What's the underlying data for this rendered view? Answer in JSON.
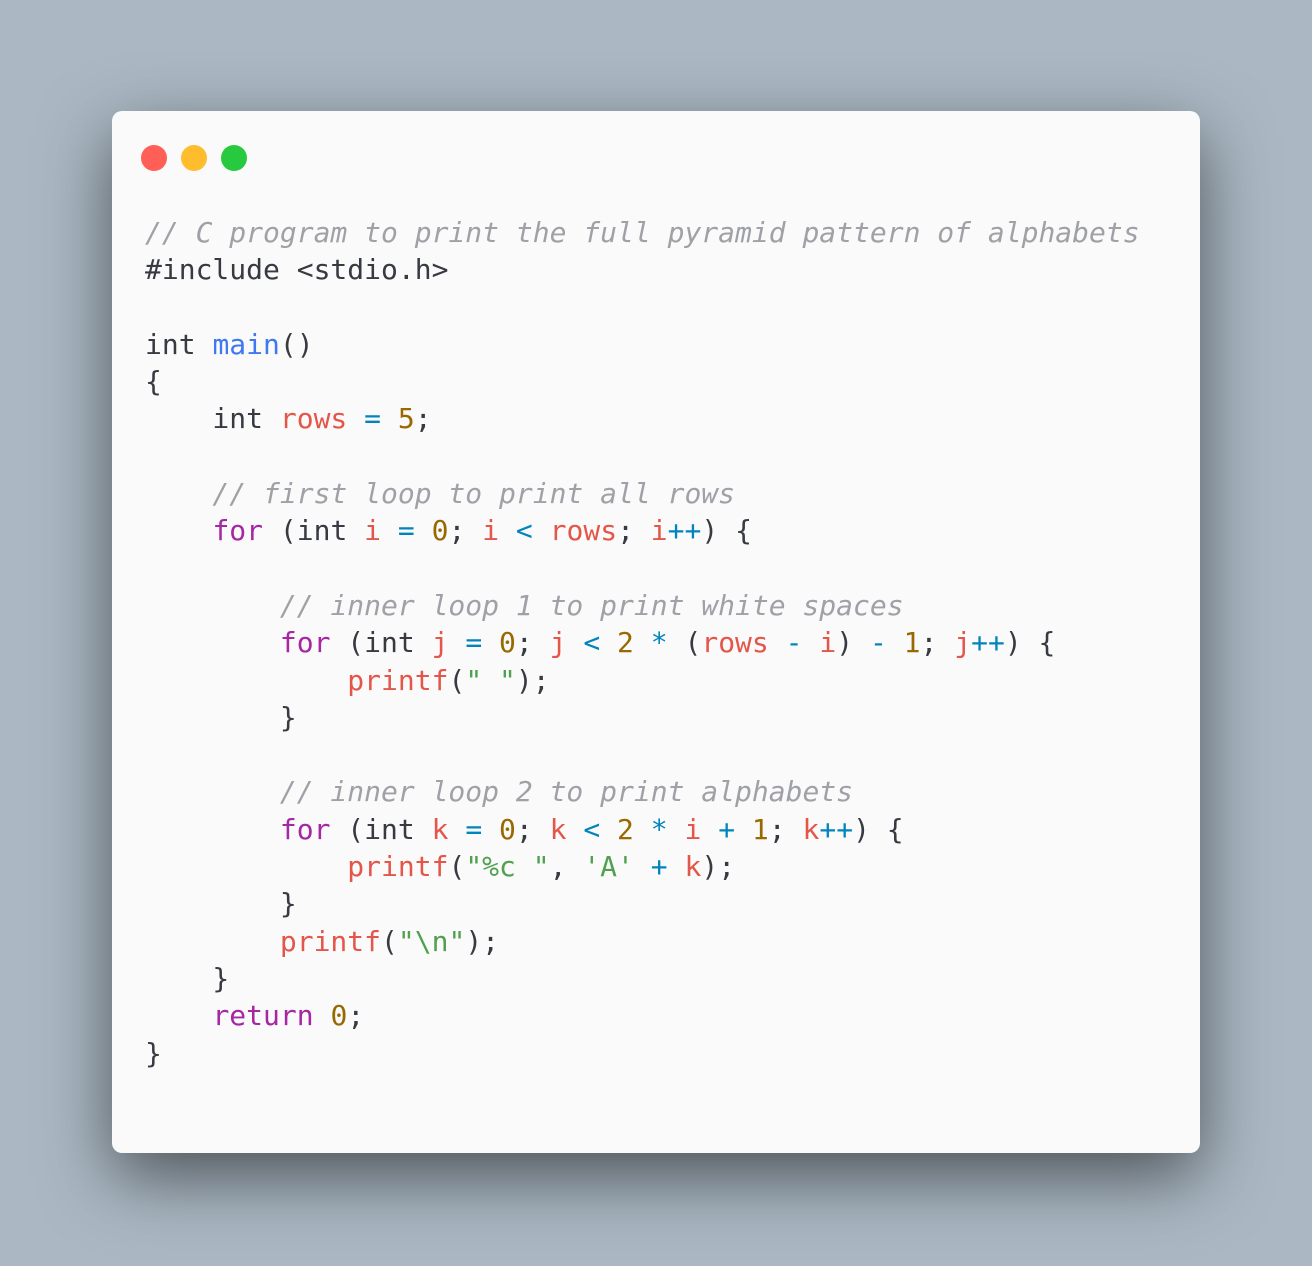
{
  "window": {
    "controls": {
      "close_color": "#ff5f56",
      "minimize_color": "#ffbd2e",
      "maximize_color": "#27c93f"
    }
  },
  "editor": {
    "language": "C",
    "lines": [
      [
        {
          "t": "// C program to print the full pyramid pattern of alphabets",
          "c": "cm"
        }
      ],
      [
        {
          "t": "#include <stdio.h>",
          "c": "pl"
        }
      ],
      [],
      [
        {
          "t": "int ",
          "c": "pl"
        },
        {
          "t": "main",
          "c": "fn"
        },
        {
          "t": "()",
          "c": "pl"
        }
      ],
      [
        {
          "t": "{",
          "c": "pl"
        }
      ],
      [
        {
          "t": "    int ",
          "c": "pl"
        },
        {
          "t": "rows",
          "c": "var"
        },
        {
          "t": " ",
          "c": "pl"
        },
        {
          "t": "=",
          "c": "op"
        },
        {
          "t": " ",
          "c": "pl"
        },
        {
          "t": "5",
          "c": "num"
        },
        {
          "t": ";",
          "c": "pl"
        }
      ],
      [],
      [
        {
          "t": "    // first loop to print all rows",
          "c": "cm"
        }
      ],
      [
        {
          "t": "    ",
          "c": "pl"
        },
        {
          "t": "for",
          "c": "kw"
        },
        {
          "t": " (int ",
          "c": "pl"
        },
        {
          "t": "i",
          "c": "var"
        },
        {
          "t": " ",
          "c": "pl"
        },
        {
          "t": "=",
          "c": "op"
        },
        {
          "t": " ",
          "c": "pl"
        },
        {
          "t": "0",
          "c": "num"
        },
        {
          "t": "; ",
          "c": "pl"
        },
        {
          "t": "i",
          "c": "var"
        },
        {
          "t": " ",
          "c": "pl"
        },
        {
          "t": "<",
          "c": "op"
        },
        {
          "t": " ",
          "c": "pl"
        },
        {
          "t": "rows",
          "c": "var"
        },
        {
          "t": "; ",
          "c": "pl"
        },
        {
          "t": "i",
          "c": "var"
        },
        {
          "t": "++",
          "c": "op"
        },
        {
          "t": ") {",
          "c": "pl"
        }
      ],
      [],
      [
        {
          "t": "        // inner loop 1 to print white spaces",
          "c": "cm"
        }
      ],
      [
        {
          "t": "        ",
          "c": "pl"
        },
        {
          "t": "for",
          "c": "kw"
        },
        {
          "t": " (int ",
          "c": "pl"
        },
        {
          "t": "j",
          "c": "var"
        },
        {
          "t": " ",
          "c": "pl"
        },
        {
          "t": "=",
          "c": "op"
        },
        {
          "t": " ",
          "c": "pl"
        },
        {
          "t": "0",
          "c": "num"
        },
        {
          "t": "; ",
          "c": "pl"
        },
        {
          "t": "j",
          "c": "var"
        },
        {
          "t": " ",
          "c": "pl"
        },
        {
          "t": "<",
          "c": "op"
        },
        {
          "t": " ",
          "c": "pl"
        },
        {
          "t": "2",
          "c": "num"
        },
        {
          "t": " ",
          "c": "pl"
        },
        {
          "t": "*",
          "c": "op"
        },
        {
          "t": " (",
          "c": "pl"
        },
        {
          "t": "rows",
          "c": "var"
        },
        {
          "t": " ",
          "c": "pl"
        },
        {
          "t": "-",
          "c": "op"
        },
        {
          "t": " ",
          "c": "pl"
        },
        {
          "t": "i",
          "c": "var"
        },
        {
          "t": ") ",
          "c": "pl"
        },
        {
          "t": "-",
          "c": "op"
        },
        {
          "t": " ",
          "c": "pl"
        },
        {
          "t": "1",
          "c": "num"
        },
        {
          "t": "; ",
          "c": "pl"
        },
        {
          "t": "j",
          "c": "var"
        },
        {
          "t": "++",
          "c": "op"
        },
        {
          "t": ") {",
          "c": "pl"
        }
      ],
      [
        {
          "t": "            ",
          "c": "pl"
        },
        {
          "t": "printf",
          "c": "var"
        },
        {
          "t": "(",
          "c": "pl"
        },
        {
          "t": "\" \"",
          "c": "str"
        },
        {
          "t": ");",
          "c": "pl"
        }
      ],
      [
        {
          "t": "        }",
          "c": "pl"
        }
      ],
      [],
      [
        {
          "t": "        // inner loop 2 to print alphabets",
          "c": "cm"
        }
      ],
      [
        {
          "t": "        ",
          "c": "pl"
        },
        {
          "t": "for",
          "c": "kw"
        },
        {
          "t": " (int ",
          "c": "pl"
        },
        {
          "t": "k",
          "c": "var"
        },
        {
          "t": " ",
          "c": "pl"
        },
        {
          "t": "=",
          "c": "op"
        },
        {
          "t": " ",
          "c": "pl"
        },
        {
          "t": "0",
          "c": "num"
        },
        {
          "t": "; ",
          "c": "pl"
        },
        {
          "t": "k",
          "c": "var"
        },
        {
          "t": " ",
          "c": "pl"
        },
        {
          "t": "<",
          "c": "op"
        },
        {
          "t": " ",
          "c": "pl"
        },
        {
          "t": "2",
          "c": "num"
        },
        {
          "t": " ",
          "c": "pl"
        },
        {
          "t": "*",
          "c": "op"
        },
        {
          "t": " ",
          "c": "pl"
        },
        {
          "t": "i",
          "c": "var"
        },
        {
          "t": " ",
          "c": "pl"
        },
        {
          "t": "+",
          "c": "op"
        },
        {
          "t": " ",
          "c": "pl"
        },
        {
          "t": "1",
          "c": "num"
        },
        {
          "t": "; ",
          "c": "pl"
        },
        {
          "t": "k",
          "c": "var"
        },
        {
          "t": "++",
          "c": "op"
        },
        {
          "t": ") {",
          "c": "pl"
        }
      ],
      [
        {
          "t": "            ",
          "c": "pl"
        },
        {
          "t": "printf",
          "c": "var"
        },
        {
          "t": "(",
          "c": "pl"
        },
        {
          "t": "\"%c \"",
          "c": "str"
        },
        {
          "t": ", ",
          "c": "pl"
        },
        {
          "t": "'A'",
          "c": "str"
        },
        {
          "t": " ",
          "c": "pl"
        },
        {
          "t": "+",
          "c": "op"
        },
        {
          "t": " ",
          "c": "pl"
        },
        {
          "t": "k",
          "c": "var"
        },
        {
          "t": ");",
          "c": "pl"
        }
      ],
      [
        {
          "t": "        }",
          "c": "pl"
        }
      ],
      [
        {
          "t": "        ",
          "c": "pl"
        },
        {
          "t": "printf",
          "c": "var"
        },
        {
          "t": "(",
          "c": "pl"
        },
        {
          "t": "\"\\n\"",
          "c": "str"
        },
        {
          "t": ");",
          "c": "pl"
        }
      ],
      [
        {
          "t": "    }",
          "c": "pl"
        }
      ],
      [
        {
          "t": "    ",
          "c": "pl"
        },
        {
          "t": "return",
          "c": "kw"
        },
        {
          "t": " ",
          "c": "pl"
        },
        {
          "t": "0",
          "c": "num"
        },
        {
          "t": ";",
          "c": "pl"
        }
      ],
      [
        {
          "t": "}",
          "c": "pl"
        }
      ]
    ]
  }
}
